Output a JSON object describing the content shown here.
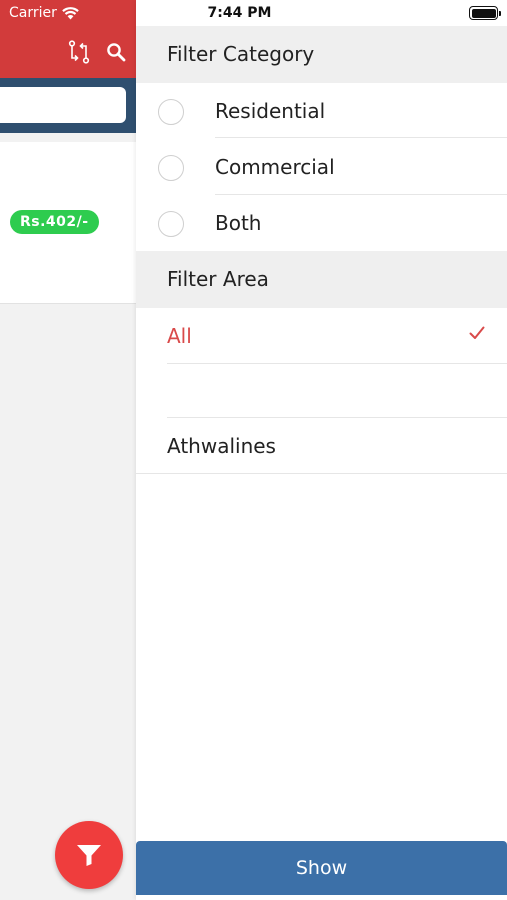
{
  "status_bar": {
    "carrier": "Carrier",
    "time": "7:44 PM"
  },
  "background": {
    "price_badge": "Rs.402/-",
    "colors": {
      "header": "#d23b3b",
      "search_bar": "#2f4f6f",
      "badge": "#2ecc4f",
      "fab": "#ef3d3d"
    },
    "icons": [
      "compare-icon",
      "search-icon",
      "filter-icon"
    ]
  },
  "filter_panel": {
    "category_title": "Filter Category",
    "categories": [
      {
        "label": "Residential",
        "selected": false
      },
      {
        "label": "Commercial",
        "selected": false
      },
      {
        "label": "Both",
        "selected": false
      }
    ],
    "area_title": "Filter Area",
    "areas": [
      {
        "label": "All",
        "selected": true
      },
      {
        "label": "",
        "selected": false
      },
      {
        "label": "Athwalines",
        "selected": false
      }
    ],
    "accent_color": "#d94a4a",
    "show_button": "Show",
    "button_color": "#3c70a8"
  }
}
